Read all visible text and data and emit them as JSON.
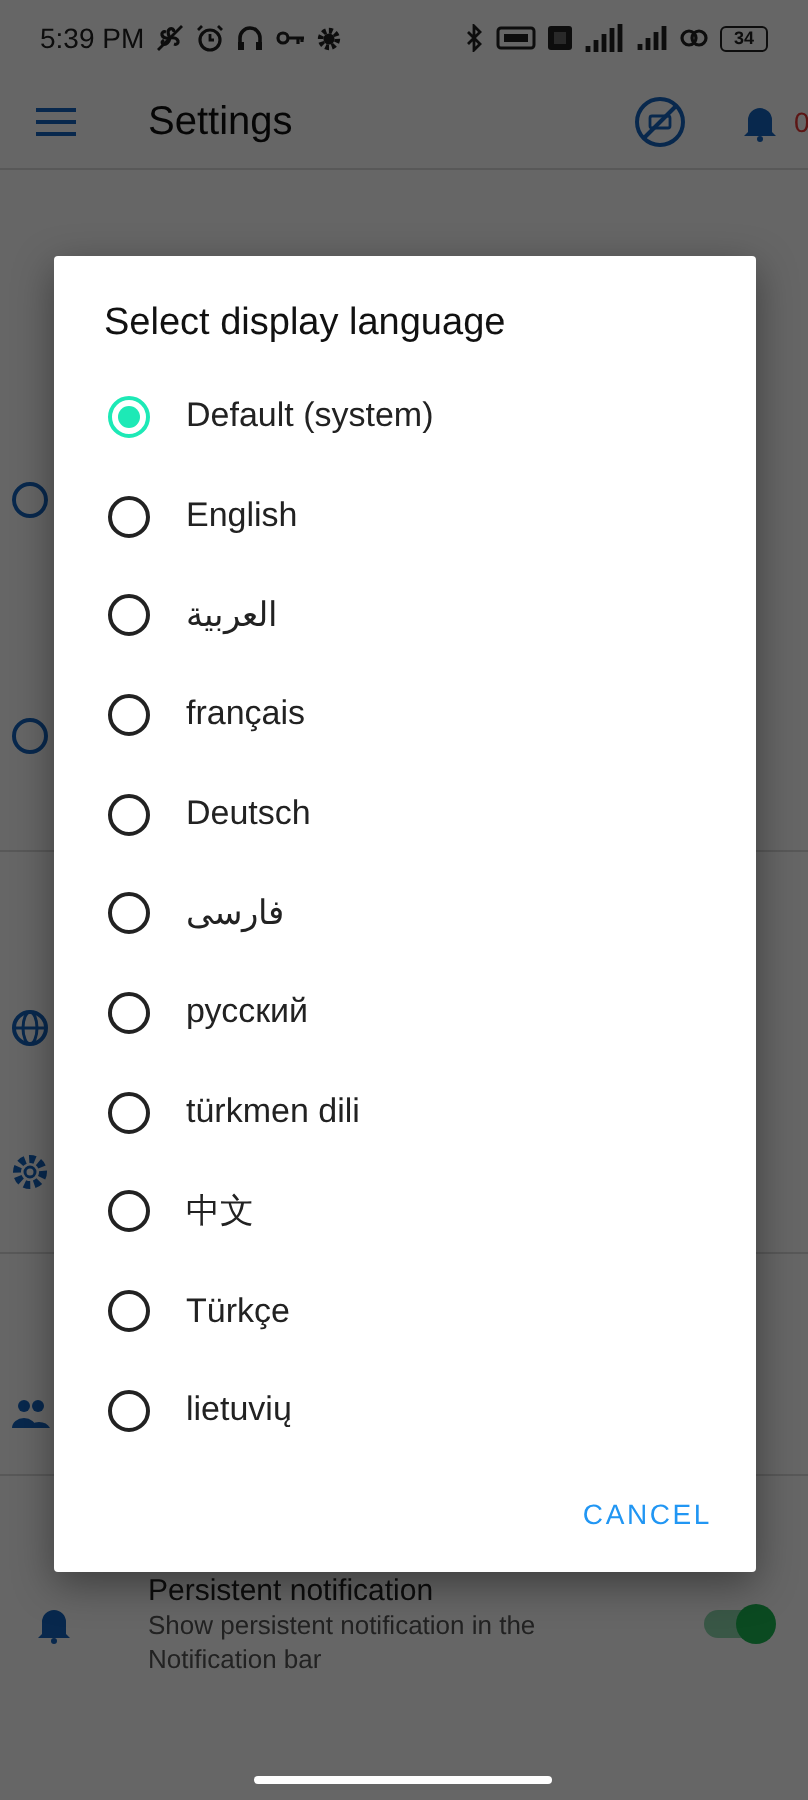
{
  "status_bar": {
    "time": "5:39 PM",
    "battery": "34"
  },
  "app_bar": {
    "title": "Settings",
    "badge": "0"
  },
  "settings": [
    {
      "kind": "switch",
      "title": "Persistent notification",
      "subtitle": "Show persistent notification in the Notification bar",
      "on": true
    }
  ],
  "dialog": {
    "title": "Select display language",
    "options": [
      {
        "label": "Default (system)",
        "selected": true
      },
      {
        "label": "English",
        "selected": false
      },
      {
        "label": "العربية",
        "selected": false
      },
      {
        "label": "français",
        "selected": false
      },
      {
        "label": "Deutsch",
        "selected": false
      },
      {
        "label": "فارسی",
        "selected": false
      },
      {
        "label": "русский",
        "selected": false
      },
      {
        "label": "türkmen dili",
        "selected": false
      },
      {
        "label": "中文",
        "selected": false
      },
      {
        "label": "Türkçe",
        "selected": false
      },
      {
        "label": "lietuvių",
        "selected": false
      }
    ],
    "buttons": [
      "CANCEL"
    ]
  }
}
